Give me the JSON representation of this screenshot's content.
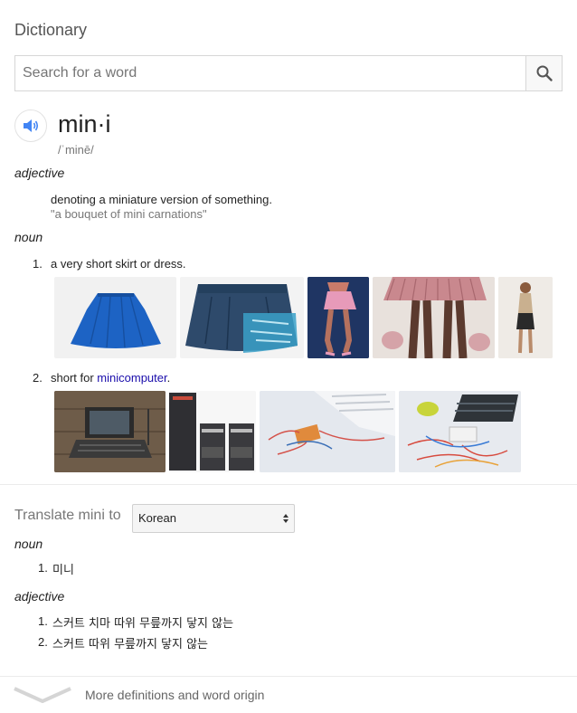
{
  "panel": {
    "title": "Dictionary"
  },
  "search": {
    "placeholder": "Search for a word"
  },
  "entry": {
    "word": "min·i",
    "phonetic": "/ˈminē/"
  },
  "adjective_sense": {
    "pos": "adjective",
    "definition": "denoting a miniature version of something.",
    "example": "\"a bouquet of mini carnations\""
  },
  "noun_sense": {
    "pos": "noun",
    "items": [
      {
        "num": "1.",
        "text": "a very short skirt or dress."
      },
      {
        "num": "2.",
        "text_prefix": "short for ",
        "link": "minicomputer",
        "text_suffix": "."
      }
    ]
  },
  "translate": {
    "label": "Translate mini to",
    "language": "Korean",
    "noun_pos": "noun",
    "noun_items": [
      {
        "num": "1.",
        "text": "미니"
      }
    ],
    "adj_pos": "adjective",
    "adj_items": [
      {
        "num": "1.",
        "text": "스커트 치마 따위 무릎까지 닿지 않는"
      },
      {
        "num": "2.",
        "text": "스커트 따위 무릎까지 닿지 않는"
      }
    ]
  },
  "footer": {
    "more_label": "More definitions and word origin"
  },
  "colors": {
    "link": "#1a0dab",
    "speaker_blue": "#4285f4",
    "divider": "#ebebeb"
  }
}
